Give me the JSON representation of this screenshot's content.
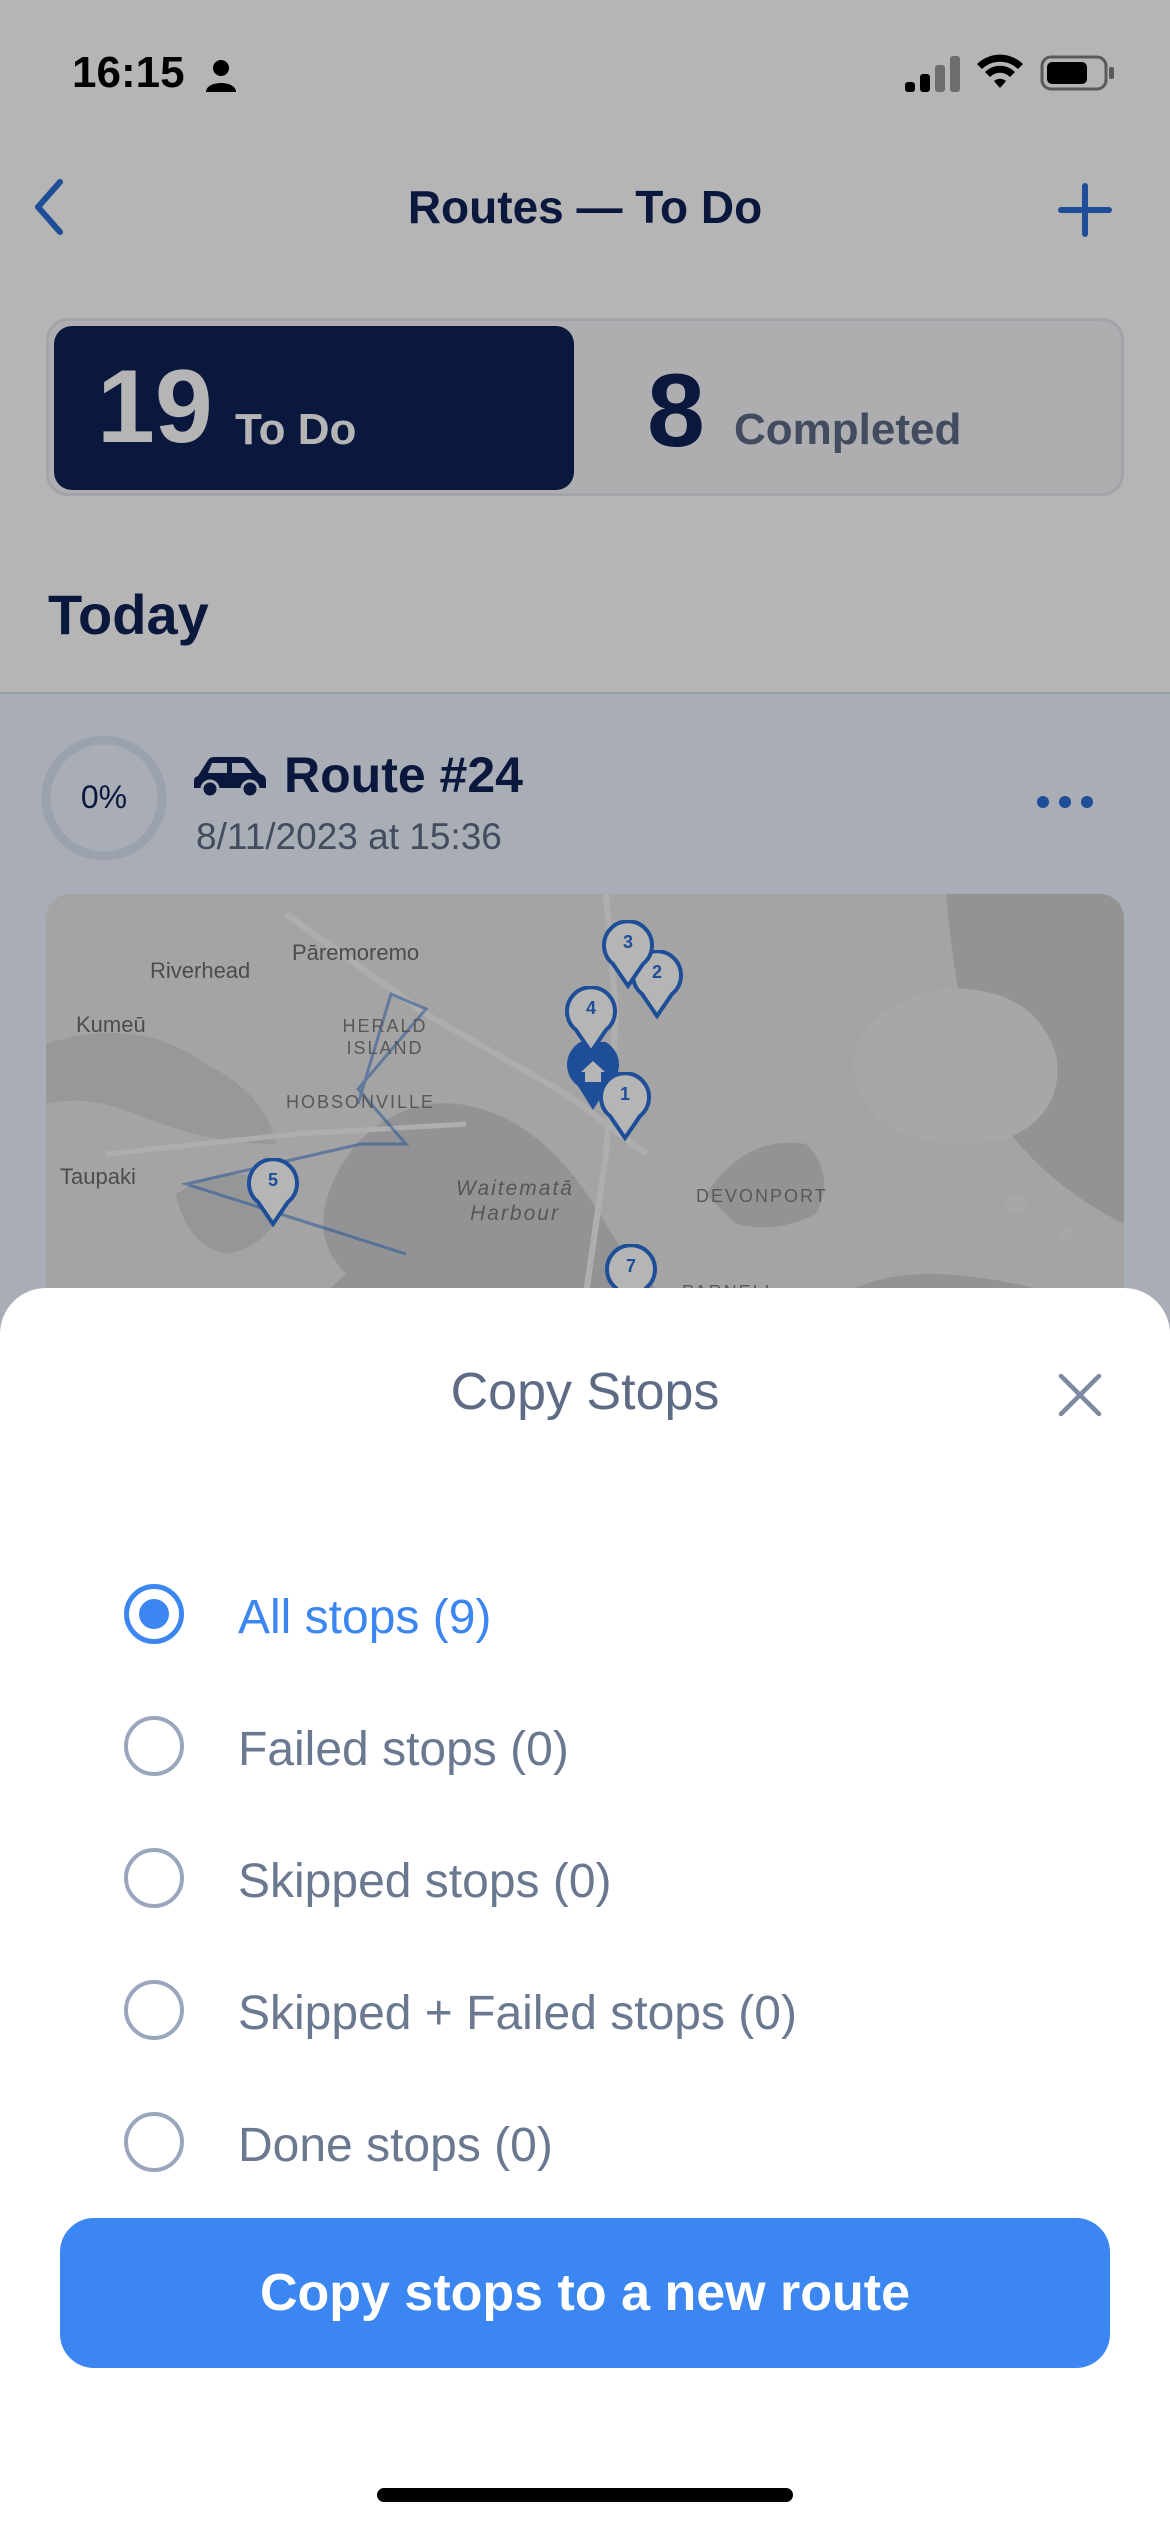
{
  "status_bar": {
    "time": "16:15"
  },
  "nav": {
    "title": "Routes — To Do"
  },
  "segments": {
    "todo": {
      "count": "19",
      "label": "To Do"
    },
    "completed": {
      "count": "8",
      "label": "Completed"
    }
  },
  "section_title": "Today",
  "route": {
    "progress": "0%",
    "progress_value": 0,
    "name": "Route #24",
    "date": "8/11/2023 at 15:36"
  },
  "map": {
    "labels": [
      "Riverhead",
      "Pāremoremo",
      "Kumeū",
      "HERALD ISLAND",
      "HOBSONVILLE",
      "Taupaki",
      "Waitematā Harbour",
      "DEVONPORT",
      "PARNELL"
    ],
    "pins": [
      "1",
      "2",
      "3",
      "4",
      "5",
      "7"
    ]
  },
  "sheet": {
    "title": "Copy Stops",
    "options": [
      {
        "label": "All stops (9)",
        "selected": true
      },
      {
        "label": "Failed stops (0)",
        "selected": false
      },
      {
        "label": "Skipped stops (0)",
        "selected": false
      },
      {
        "label": "Skipped + Failed stops (0)",
        "selected": false
      },
      {
        "label": "Done stops (0)",
        "selected": false
      }
    ],
    "button_label": "Copy stops to a new route"
  },
  "colors": {
    "navy": "#0f2257",
    "accent": "#3b86f0",
    "muted": "#6a7890"
  }
}
